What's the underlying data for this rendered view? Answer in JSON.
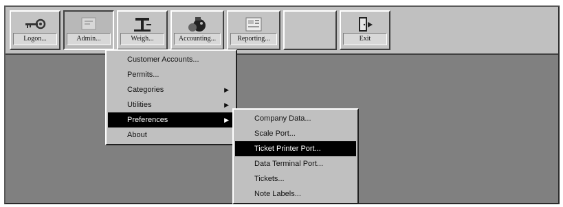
{
  "toolbar": {
    "buttons": [
      {
        "id": "logon",
        "label": "Logon...",
        "icon": "key-icon"
      },
      {
        "id": "admin",
        "label": "Admin...",
        "icon": "admin-icon"
      },
      {
        "id": "weigh",
        "label": "Weigh...",
        "icon": "scale-icon"
      },
      {
        "id": "accounting",
        "label": "Accounting...",
        "icon": "accounting-icon"
      },
      {
        "id": "reporting",
        "label": "Reporting...",
        "icon": "reporting-icon"
      },
      {
        "id": "exit",
        "label": "Exit",
        "icon": "exit-door-icon"
      }
    ]
  },
  "admin_menu": {
    "items": [
      {
        "label": "Customer Accounts..."
      },
      {
        "label": "Permits..."
      },
      {
        "label": "Categories",
        "submenu": true
      },
      {
        "label": "Utilities",
        "submenu": true
      },
      {
        "label": "Preferences",
        "submenu": true,
        "selected": true
      },
      {
        "label": "About"
      }
    ]
  },
  "preferences_menu": {
    "items": [
      {
        "label": "Company Data..."
      },
      {
        "label": "Scale Port..."
      },
      {
        "label": "Ticket Printer Port...",
        "selected": true
      },
      {
        "label": "Data Terminal Port..."
      },
      {
        "label": "Tickets..."
      },
      {
        "label": "Note Labels..."
      }
    ]
  },
  "colors": {
    "desktop": "#808080",
    "menu_bg": "#c0c0c0",
    "selection_bg": "#000000",
    "selection_fg": "#ffffff"
  }
}
